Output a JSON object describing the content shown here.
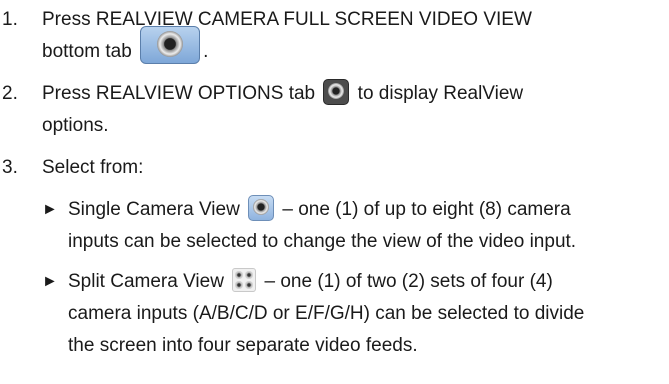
{
  "steps": [
    {
      "number": "1.",
      "line1": "Press REALVIEW CAMERA FULL SCREEN VIDEO VIEW",
      "line2_before": "bottom tab",
      "line2_after": ".",
      "icon": "realview-camera-tab-icon"
    },
    {
      "number": "2.",
      "line1_before": "Press REALVIEW OPTIONS tab",
      "line1_after": "to display RealView",
      "line2": "options.",
      "icon": "realview-options-tab-icon"
    },
    {
      "number": "3.",
      "line1": "Select from:"
    }
  ],
  "options": [
    {
      "bullet": "►",
      "line1_before": "Single Camera View",
      "line1_after": "– one (1) of up to eight (8) camera",
      "line2": "inputs can be selected to change the view of the video input.",
      "icon": "single-camera-icon"
    },
    {
      "bullet": "►",
      "line1_before": "Split Camera View",
      "line1_after": "– one (1) of two (2) sets of four (4)",
      "line2": "camera inputs (A/B/C/D or E/F/G/H) can be selected to divide",
      "line3": "the screen into four separate video feeds.",
      "icon": "split-camera-icon"
    }
  ]
}
